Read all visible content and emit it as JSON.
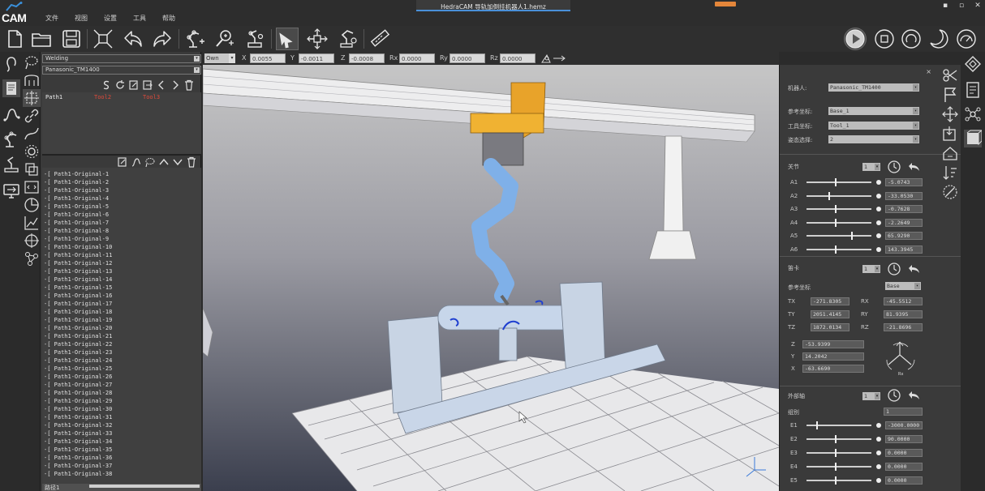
{
  "app": {
    "window_title": "HedraCAM   导轨加倒挂机器人1.hemz",
    "brand": "CAM",
    "menu": [
      "文件",
      "视图",
      "设置",
      "工具",
      "帮助"
    ]
  },
  "toolbar": {
    "left_icons": [
      "new-file-icon",
      "open-folder-icon",
      "save-icon",
      "fit-view-icon",
      "undo-icon",
      "redo-icon",
      "robot-add-icon",
      "tool-add-icon",
      "robot-setup-icon",
      "select-arrow-icon",
      "move-icon",
      "robot-config-icon",
      "ruler-icon"
    ],
    "right_icons": [
      "play-icon",
      "stop-icon",
      "rotate-icon",
      "half-moon-icon",
      "gauge-icon"
    ]
  },
  "coordbar": {
    "frame": "Own",
    "fields": [
      {
        "label": "X",
        "value": "0.0055"
      },
      {
        "label": "Y",
        "value": "-0.0011"
      },
      {
        "label": "Z",
        "value": "-0.0008"
      },
      {
        "label": "Rx",
        "value": "0.0000"
      },
      {
        "label": "Ry",
        "value": "0.0000"
      },
      {
        "label": "Rz",
        "value": "0.0000"
      }
    ]
  },
  "left_panel": {
    "process": "Welding",
    "robot": "Panasonic_TM1400",
    "path_row": {
      "name": "Path1",
      "tool1": "Tool2",
      "tool2": "Tool3"
    },
    "points": [
      "-[ Path1-Original-1",
      "-[ Path1-Original-2",
      "-[ Path1-Original-3",
      "-[ Path1-Original-4",
      "-[ Path1-Original-5",
      "-[ Path1-Original-6",
      "-[ Path1-Original-7",
      "-[ Path1-Original-8",
      "-[ Path1-Original-9",
      "-[ Path1-Original-10",
      "-[ Path1-Original-11",
      "-[ Path1-Original-12",
      "-[ Path1-Original-13",
      "-[ Path1-Original-14",
      "-[ Path1-Original-15",
      "-[ Path1-Original-16",
      "-[ Path1-Original-17",
      "-[ Path1-Original-18",
      "-[ Path1-Original-19",
      "-[ Path1-Original-20",
      "-[ Path1-Original-21",
      "-[ Path1-Original-22",
      "-[ Path1-Original-23",
      "-[ Path1-Original-24",
      "-[ Path1-Original-25",
      "-[ Path1-Original-26",
      "-[ Path1-Original-27",
      "-[ Path1-Original-28",
      "-[ Path1-Original-29",
      "-[ Path1-Original-30",
      "-[ Path1-Original-31",
      "-[ Path1-Original-32",
      "-[ Path1-Original-33",
      "-[ Path1-Original-34",
      "-[ Path1-Original-35",
      "-[ Path1-Original-36",
      "-[ Path1-Original-37",
      "-[ Path1-Original-38"
    ],
    "bottom_label": "路径1"
  },
  "right_panel": {
    "robot_label": "机器人:",
    "robot_value": "Panasonic_TM1400",
    "ref_frame_label": "参考坐标:",
    "ref_frame_value": "Base_1",
    "tool_frame_label": "工具坐标:",
    "tool_frame_value": "Tool_1",
    "config_label": "姿态选择:",
    "config_value": "2",
    "joints_label": "关节",
    "joints_step": "1",
    "joints": [
      {
        "label": "A1",
        "value": "-5.0743",
        "pos": 0.45
      },
      {
        "label": "A2",
        "value": "-33.0530",
        "pos": 0.35
      },
      {
        "label": "A3",
        "value": "-0.7628",
        "pos": 0.45
      },
      {
        "label": "A4",
        "value": "-2.2649",
        "pos": 0.45
      },
      {
        "label": "A5",
        "value": "65.9290",
        "pos": 0.7
      },
      {
        "label": "A6",
        "value": "143.3945",
        "pos": 0.45
      }
    ],
    "cartesian_label": "笛卡",
    "cartesian_step": "1",
    "cart_ref_label": "参考坐标",
    "cart_ref_value": "Base",
    "cartesian": [
      {
        "label": "TX",
        "value": "-271.8305",
        "label2": "RX",
        "value2": "-45.5512"
      },
      {
        "label": "TY",
        "value": "2051.4145",
        "label2": "RY",
        "value2": "81.9395"
      },
      {
        "label": "TZ",
        "value": "1872.0134",
        "label2": "RZ",
        "value2": "-21.8696"
      }
    ],
    "wrist": [
      {
        "label": "Z",
        "value": "-53.9399"
      },
      {
        "label": "Y",
        "value": "14.2042"
      },
      {
        "label": "X",
        "value": "-63.6690"
      }
    ],
    "external_label": "外部轴",
    "external_step": "1",
    "external_group_label": "组别",
    "external_group_value": "1",
    "external": [
      {
        "label": "E1",
        "value": "-3000.0000",
        "pos": 0.15
      },
      {
        "label": "E2",
        "value": "90.0000",
        "pos": 0.45
      },
      {
        "label": "E3",
        "value": "0.0000",
        "pos": 0.45
      },
      {
        "label": "E4",
        "value": "0.0000",
        "pos": 0.45
      },
      {
        "label": "E5",
        "value": "0.0000",
        "pos": 0.45
      }
    ],
    "close": "×"
  }
}
